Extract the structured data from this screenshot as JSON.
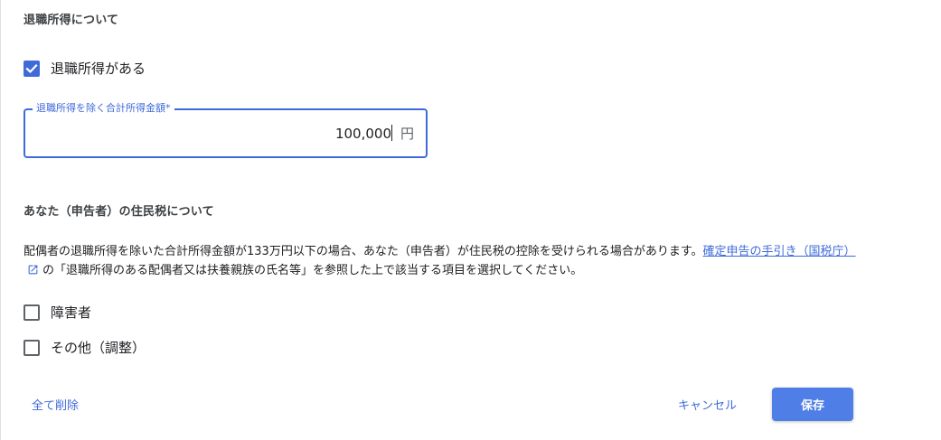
{
  "retirement_section": {
    "title": "退職所得について",
    "has_retirement_income_label": "退職所得がある",
    "has_retirement_income_checked": true,
    "income_field": {
      "label": "退職所得を除く合計所得金額*",
      "value": "100,000",
      "unit": "円"
    }
  },
  "resident_tax_section": {
    "title": "あなた（申告者）の住民税について",
    "description_before_link": "配偶者の退職所得を除いた合計所得金額が133万円以下の場合、あなた（申告者）が住民税の控除を受けられる場合があります。",
    "link_text": "確定申告の手引き（国税庁）",
    "description_after_link": "の「退職所得のある配偶者又は扶養親族の氏名等」を参照した上で該当する項目を選択してください。",
    "options": [
      {
        "label": "障害者",
        "checked": false
      },
      {
        "label": "その他（調整）",
        "checked": false
      }
    ]
  },
  "footer": {
    "clear_all_label": "全て削除",
    "cancel_label": "キャンセル",
    "save_label": "保存"
  },
  "colors": {
    "accent": "#3f6ad8",
    "save_button": "#4f7fe6"
  },
  "icons": {
    "checkbox_checked": "check-icon",
    "external_link": "external-link-icon"
  }
}
